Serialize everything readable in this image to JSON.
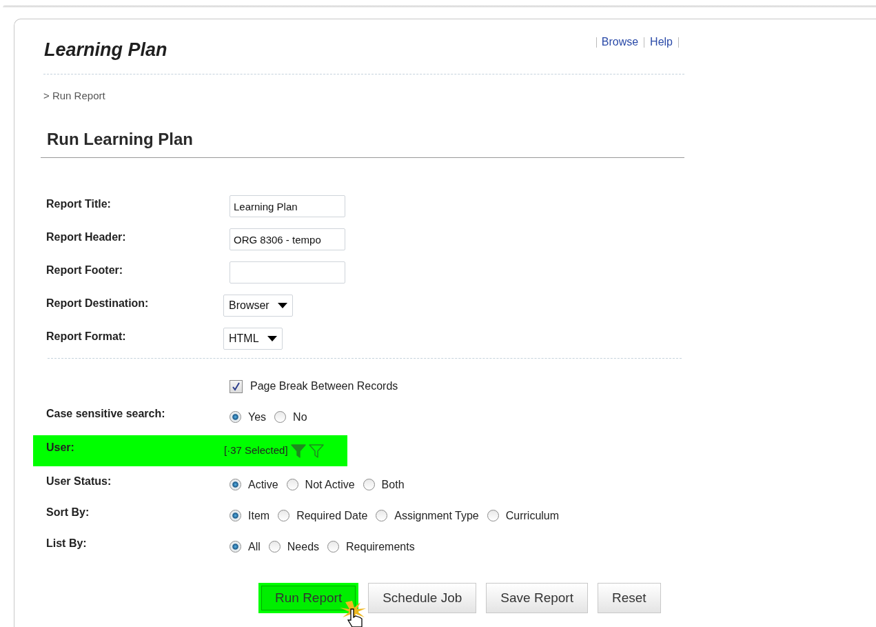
{
  "header": {
    "title": "Learning Plan",
    "links": [
      "Browse",
      "Help"
    ]
  },
  "breadcrumb": "> Run Report",
  "heading": "Run Learning Plan",
  "fields": [
    {
      "kind": "text",
      "label": "Report Title:",
      "value": "Learning Plan"
    },
    {
      "kind": "text",
      "label": "Report Header:",
      "value": "ORG 8306 - tempo"
    },
    {
      "kind": "text",
      "label": "Report Footer:"
    },
    {
      "kind": "select",
      "label": "Report Destination:",
      "value": "Browser"
    },
    {
      "kind": "select",
      "label": "Report Format:",
      "value": "HTML"
    }
  ],
  "page_break": {
    "label": "Page Break Between Records",
    "checked": true
  },
  "options": [
    {
      "kind": "radio",
      "label": "Case sensitive search:",
      "highlighted": false,
      "choices": [
        {
          "label": "Yes",
          "selected": true
        },
        {
          "label": "No",
          "selected": false
        }
      ]
    },
    {
      "kind": "filter",
      "label": "User:",
      "highlighted": true,
      "value": "[·37 Selected]"
    },
    {
      "kind": "radio",
      "label": "User Status:",
      "highlighted": false,
      "choices": [
        {
          "label": "Active",
          "selected": true
        },
        {
          "label": "Not Active",
          "selected": false
        },
        {
          "label": "Both",
          "selected": false
        }
      ]
    },
    {
      "kind": "radio",
      "label": "Sort By:",
      "highlighted": false,
      "choices": [
        {
          "label": "Item",
          "selected": true
        },
        {
          "label": "Required Date",
          "selected": false
        },
        {
          "label": "Assignment Type",
          "selected": false
        },
        {
          "label": "Curriculum",
          "selected": false
        }
      ]
    },
    {
      "kind": "radio",
      "label": "List By:",
      "highlighted": false,
      "choices": [
        {
          "label": "All",
          "selected": true
        },
        {
          "label": "Needs",
          "selected": false
        },
        {
          "label": "Requirements",
          "selected": false
        }
      ]
    }
  ],
  "buttons": [
    {
      "label": "Run Report",
      "highlighted": true
    },
    {
      "label": "Schedule Job",
      "highlighted": false
    },
    {
      "label": "Save Report",
      "highlighted": false
    },
    {
      "label": "Reset",
      "highlighted": false
    }
  ]
}
